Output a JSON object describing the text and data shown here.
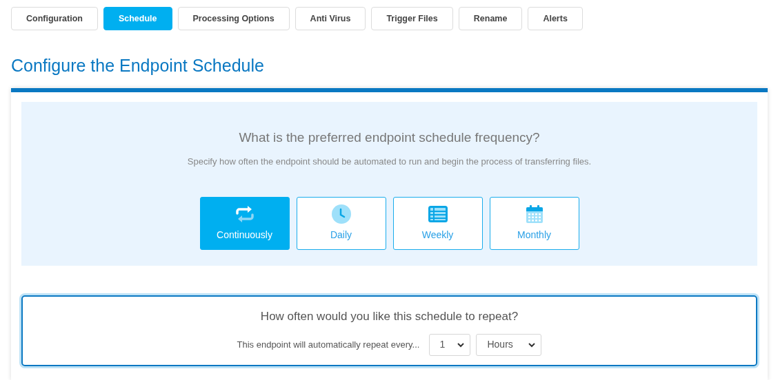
{
  "tabs": [
    {
      "label": "Configuration",
      "selected": false
    },
    {
      "label": "Schedule",
      "selected": true
    },
    {
      "label": "Processing Options",
      "selected": false
    },
    {
      "label": "Anti Virus",
      "selected": false
    },
    {
      "label": "Trigger Files",
      "selected": false
    },
    {
      "label": "Rename",
      "selected": false
    },
    {
      "label": "Alerts",
      "selected": false
    }
  ],
  "heading": "Configure the Endpoint Schedule",
  "frequency": {
    "question": "What is the preferred endpoint schedule frequency?",
    "description": "Specify how often the endpoint should be automated to run and begin the process of transferring files.",
    "options": [
      {
        "kind": "repeat",
        "label": "Continuously",
        "selected": true
      },
      {
        "kind": "clock",
        "label": "Daily",
        "selected": false
      },
      {
        "kind": "list",
        "label": "Weekly",
        "selected": false
      },
      {
        "kind": "calendar",
        "label": "Monthly",
        "selected": false
      }
    ]
  },
  "repeat": {
    "question": "How often would you like this schedule to repeat?",
    "label": "This endpoint will automatically repeat every...",
    "amount": "1",
    "unit": "Hours"
  }
}
